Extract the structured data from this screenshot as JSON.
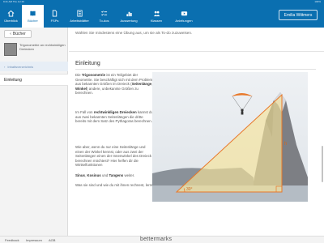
{
  "status_bar": {
    "left": "9:41 AM  Thu Jul 29",
    "right": "100%"
  },
  "nav": {
    "items": [
      {
        "label": "Überblick",
        "icon": "home-icon"
      },
      {
        "label": "Bücher",
        "icon": "book-icon",
        "active": true
      },
      {
        "label": "FSPs",
        "icon": "document-icon"
      },
      {
        "label": "Arbeitsblätter",
        "icon": "worksheet-icon"
      },
      {
        "label": "To-dos",
        "icon": "checklist-icon"
      },
      {
        "label": "Auswertung",
        "icon": "chart-icon"
      },
      {
        "label": "Klassen",
        "icon": "people-icon"
      },
      {
        "label": "Anleitungen",
        "icon": "video-icon"
      }
    ],
    "user": "Emilia Wittmers"
  },
  "sidebar": {
    "back": "Bücher",
    "book_title": "Trigonometrie an rechtwinkligen Dreiecken",
    "toc_toggle": "Inhaltsverzeichnis",
    "entry": "Einleitung"
  },
  "main": {
    "instruction": "Wählen Sie mindestens eine Übung aus, um sie als To-do zuzuweisen.",
    "title": "Einleitung",
    "p1_pre": "Die ",
    "p1_b1": "Trigonometrie",
    "p1_mid": " ist ein Teilgebiet der Geometrie. Sie beschäftigt sich mit dem Problem, aus bekannten Größen im Dreieck (",
    "p1_b2": "Seitenlänge",
    "p1_mid2": ", ",
    "p1_b3": "Winkel",
    "p1_post": ") andere, unbekannte Größen zu berechnen.",
    "p2_pre": "Im Fall von ",
    "p2_b": "rechtwinkligen Dreiecken",
    "p2_post": " kannst du aus zwei bekannten Seitenlängen die dritte bereits mit dem Satz des Pythagoras berechnen.",
    "p3": "Wie aber, wenn du nur eine Seitenlänge und einen der Winkel kennst, oder aus zwei der Seitenlängen einen der Innenwinkel des Dreieck berechnen möchtest? Hier helfen dir die Winkelfunktionen",
    "p3_b1": "Sinus",
    "p3_b2": "Kosinus",
    "p3_b3": "Tangens",
    "p3_post": " weiter.",
    "p4": "Was sie sind und wie du mit ihnen rechnest, lernst du in diesem Buch."
  },
  "figure": {
    "label_30": "30°",
    "label_h": "h"
  },
  "footer": {
    "links": [
      "Feedback",
      "Impressum",
      "AGB"
    ],
    "brand": "bettermarks"
  },
  "colors": {
    "primary": "#0a6fb0",
    "accent": "#e8782a",
    "triangle_fill": "#f6e39a"
  }
}
